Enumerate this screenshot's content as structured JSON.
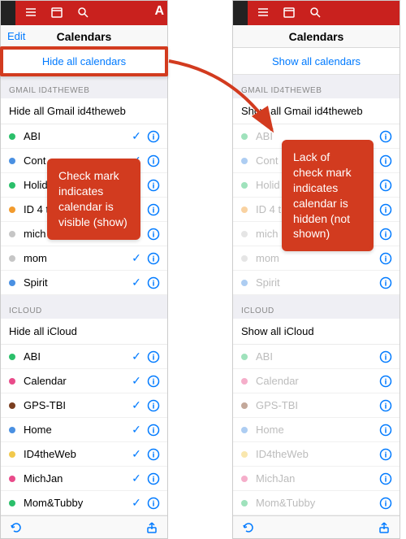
{
  "colors": {
    "accent": "#007aff",
    "red": "#c9211e",
    "callout": "#d23b1f"
  },
  "left": {
    "header_edit": "Edit",
    "header_title": "Calendars",
    "toggle_all": "Hide all calendars",
    "groups": [
      {
        "name": "GMAIL ID4THEWEB",
        "group_action": "Hide all Gmail id4theweb",
        "items": [
          {
            "label": "ABI",
            "color": "#2bbf6a",
            "checked": true
          },
          {
            "label": "Cont",
            "color": "#4a90e2",
            "checked": true
          },
          {
            "label": "Holid",
            "color": "#2bbf6a",
            "checked": true
          },
          {
            "label": "ID 4 t",
            "color": "#f29b2e",
            "checked": true
          },
          {
            "label": "mich",
            "color": "#c6c6c6",
            "checked": true
          },
          {
            "label": "mom",
            "color": "#c6c6c6",
            "checked": true
          },
          {
            "label": "Spirit",
            "color": "#4a90e2",
            "checked": true
          }
        ]
      },
      {
        "name": "ICLOUD",
        "group_action": "Hide all iCloud",
        "items": [
          {
            "label": "ABI",
            "color": "#2bbf6a",
            "checked": true
          },
          {
            "label": "Calendar",
            "color": "#e94b8a",
            "checked": true
          },
          {
            "label": "GPS-TBI",
            "color": "#7a3e1f",
            "checked": true
          },
          {
            "label": "Home",
            "color": "#4a90e2",
            "checked": true
          },
          {
            "label": "ID4theWeb",
            "color": "#f2c94c",
            "checked": true
          },
          {
            "label": "MichJan",
            "color": "#e94b8a",
            "checked": true
          },
          {
            "label": "Mom&Tubby",
            "color": "#2bbf6a",
            "checked": true
          }
        ]
      }
    ]
  },
  "right": {
    "header_title": "Calendars",
    "toggle_all": "Show all calendars",
    "groups": [
      {
        "name": "GMAIL ID4THEWEB",
        "group_action": "Show all Gmail id4theweb",
        "items": [
          {
            "label": "ABI",
            "color": "#2bbf6a",
            "checked": false
          },
          {
            "label": "Cont",
            "color": "#4a90e2",
            "checked": false
          },
          {
            "label": "Holid",
            "color": "#2bbf6a",
            "checked": false
          },
          {
            "label": "ID 4 t",
            "color": "#f29b2e",
            "checked": false
          },
          {
            "label": "mich",
            "color": "#c6c6c6",
            "checked": false
          },
          {
            "label": "mom",
            "color": "#c6c6c6",
            "checked": false
          },
          {
            "label": "Spirit",
            "color": "#4a90e2",
            "checked": false
          }
        ]
      },
      {
        "name": "ICLOUD",
        "group_action": "Show all iCloud",
        "items": [
          {
            "label": "ABI",
            "color": "#2bbf6a",
            "checked": false
          },
          {
            "label": "Calendar",
            "color": "#e94b8a",
            "checked": false
          },
          {
            "label": "GPS-TBI",
            "color": "#7a3e1f",
            "checked": false
          },
          {
            "label": "Home",
            "color": "#4a90e2",
            "checked": false
          },
          {
            "label": "ID4theWeb",
            "color": "#f2c94c",
            "checked": false
          },
          {
            "label": "MichJan",
            "color": "#e94b8a",
            "checked": false
          },
          {
            "label": "Mom&Tubby",
            "color": "#2bbf6a",
            "checked": false
          }
        ]
      }
    ]
  },
  "annotations": {
    "left_text": "Check mark indicates calendar is visible (show)",
    "right_text": "Lack of check mark indicates calendar is hidden (not shown)"
  },
  "topbar_letter": "A"
}
